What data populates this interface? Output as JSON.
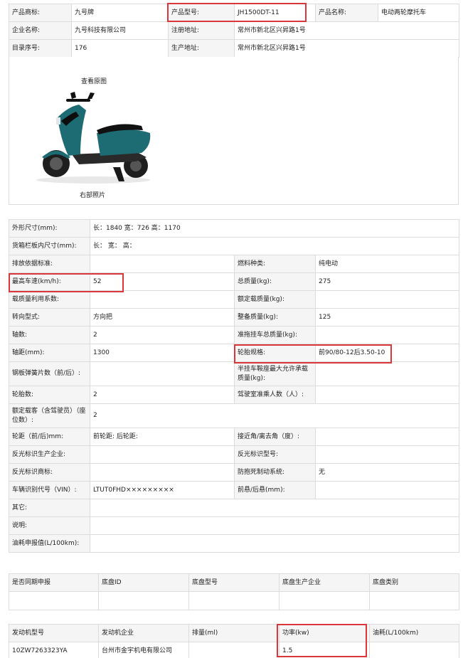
{
  "top": {
    "brand_label": "产品商标:",
    "brand": "九号牌",
    "model_label": "产品型号:",
    "model": "JH1500DT-11",
    "name_label": "产品名称:",
    "name": "电动两轮摩托车",
    "company_label": "企业名称:",
    "company": "九号科技有限公司",
    "reg_addr_label": "注册地址:",
    "reg_addr": "常州市新北区兴昇路1号",
    "catalog_label": "目录序号:",
    "catalog": "176",
    "prod_addr_label": "生产地址:",
    "prod_addr": "常州市新北区兴昇路1号"
  },
  "image": {
    "view_original": "查看原图",
    "caption": "右部照片"
  },
  "spec": {
    "dims_label": "外形尺寸(mm):",
    "dims": "长：1840 宽：726 高：1170",
    "cargo_label": "货箱栏板内尺寸(mm):",
    "cargo": "长：  宽：  高：",
    "emission_label": "排放依据标准:",
    "emission": "",
    "fuel_label": "燃料种类:",
    "fuel": "纯电动",
    "speed_label": "最高车速(km/h):",
    "speed": "52",
    "total_mass_label": "总质量(kg):",
    "total_mass": "275",
    "load_coef_label": "载质量利用系数:",
    "load_coef": "",
    "rated_load_label": "额定载质量(kg):",
    "rated_load": "",
    "steering_label": "转向型式:",
    "steering": "方向把",
    "curb_label": "整备质量(kg):",
    "curb": "125",
    "axles_label": "轴数:",
    "axles": "2",
    "trailer_label": "准拖挂车总质量(kg):",
    "trailer": "",
    "wheelbase_label": "轴距(mm):",
    "wheelbase": "1300",
    "tire_label": "轮胎规格:",
    "tire": "前90/80-12后3.50-10",
    "spring_label": "钢板弹簧片数（前/后）:",
    "spring": "",
    "saddle_label": "半挂车鞍座最大允许承载质量(kg):",
    "saddle": "",
    "tires_label": "轮胎数:",
    "tires": "2",
    "cab_label": "驾驶室准乘人数（人）:",
    "cab": "",
    "seats_label": "额定载客（含驾驶员）（座位数）:",
    "seats": "2",
    "track_label": "轮距（前/后)mm:",
    "track": "前轮距: 后轮距:",
    "angle_label": "接近角/离去角（度）:",
    "angle": "",
    "reflector_maker_label": "反光标识生产企业:",
    "reflector_maker": "",
    "reflector_model_label": "反光标识型号:",
    "reflector_model": "",
    "reflector_brand_label": "反光标识商标:",
    "reflector_brand": "",
    "abs_label": "防抱死制动系统:",
    "abs": "无",
    "vin_label": "车辆识别代号（VIN）:",
    "vin": "LTUT0FHD×××××××××",
    "overhang_label": "前悬/后悬(mm):",
    "overhang": "",
    "other_label": "其它:",
    "other": "",
    "note_label": "说明:",
    "note": "",
    "fuel_cons_label": "油耗申报值(L/100km):",
    "fuel_cons": ""
  },
  "chassis": {
    "headers": [
      "是否同期申报",
      "底盘ID",
      "底盘型号",
      "底盘生产企业",
      "底盘类别"
    ],
    "values": [
      "",
      "",
      "",
      "",
      ""
    ]
  },
  "engine": {
    "headers": [
      "发动机型号",
      "发动机企业",
      "排量(ml)",
      "功率(kw)",
      "油耗(L/100km)"
    ],
    "values": [
      "10ZW7263323YA",
      "台州市金宇机电有限公司",
      "",
      "1.5",
      ""
    ]
  },
  "colors": {
    "label_bg": "#f5f5f5",
    "border": "#dcdcdc",
    "highlight": "#d9373a",
    "scooter_body": "#1d6b73"
  }
}
